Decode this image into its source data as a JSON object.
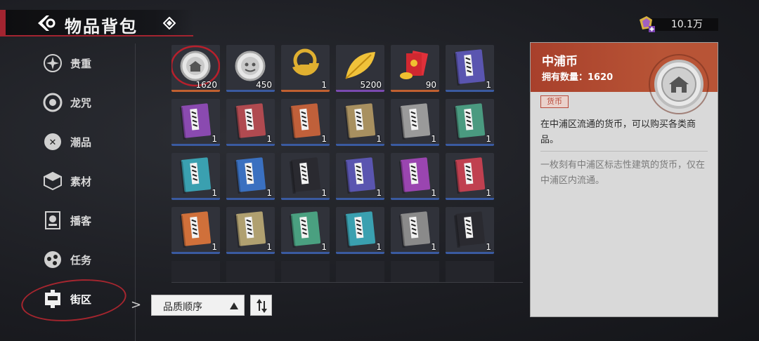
{
  "header": {
    "title": "物品背包"
  },
  "currency": {
    "amount": "10.1万"
  },
  "sidebar": {
    "items": [
      {
        "label": "贵重",
        "icon": "valuable-icon"
      },
      {
        "label": "龙咒",
        "icon": "dragon-spell-icon"
      },
      {
        "label": "潮品",
        "icon": "trend-icon"
      },
      {
        "label": "素材",
        "icon": "material-icon"
      },
      {
        "label": "播客",
        "icon": "podcast-icon"
      },
      {
        "label": "任务",
        "icon": "quest-icon"
      },
      {
        "label": "街区",
        "icon": "district-icon",
        "active": true
      }
    ]
  },
  "grid": {
    "items": [
      {
        "kind": "coin-silver-building",
        "qty": "1620",
        "rarity": "#c06030",
        "selected": true
      },
      {
        "kind": "coin-silver-face",
        "qty": "450",
        "rarity": "#3a5aa0"
      },
      {
        "kind": "gold-half-coin",
        "qty": "1",
        "rarity": "#c06030"
      },
      {
        "kind": "gold-leaf",
        "qty": "5200",
        "rarity": "#7a4ab0"
      },
      {
        "kind": "red-envelope",
        "qty": "90",
        "rarity": "#c06030"
      },
      {
        "kind": "book",
        "color": "#5a55b0",
        "qty": "1",
        "rarity": "#3a5aa0"
      },
      {
        "kind": "book",
        "color": "#8a4ab0",
        "qty": "1",
        "rarity": "#3a5aa0"
      },
      {
        "kind": "book",
        "color": "#b04a50",
        "qty": "1",
        "rarity": "#3a5aa0"
      },
      {
        "kind": "book",
        "color": "#c0603a",
        "qty": "1",
        "rarity": "#3a5aa0"
      },
      {
        "kind": "book",
        "color": "#a89060",
        "qty": "1",
        "rarity": "#3a5aa0"
      },
      {
        "kind": "book",
        "color": "#9a9a9a",
        "qty": "1",
        "rarity": "#3a5aa0"
      },
      {
        "kind": "book",
        "color": "#4a9a80",
        "qty": "1",
        "rarity": "#3a5aa0"
      },
      {
        "kind": "book",
        "color": "#3aa0b0",
        "qty": "1",
        "rarity": "#3a5aa0"
      },
      {
        "kind": "book",
        "color": "#3a70c0",
        "qty": "1",
        "rarity": "#3a5aa0"
      },
      {
        "kind": "book",
        "color": "#2a2a30",
        "qty": "1",
        "rarity": "#3a5aa0"
      },
      {
        "kind": "book",
        "color": "#5a55b0",
        "qty": "1",
        "rarity": "#3a5aa0"
      },
      {
        "kind": "book",
        "color": "#9a45b0",
        "qty": "1",
        "rarity": "#3a5aa0"
      },
      {
        "kind": "book",
        "color": "#c04050",
        "qty": "1",
        "rarity": "#3a5aa0"
      },
      {
        "kind": "book",
        "color": "#d0703a",
        "qty": "1",
        "rarity": "#3a5aa0"
      },
      {
        "kind": "book",
        "color": "#b0a070",
        "qty": "1",
        "rarity": "#3a5aa0"
      },
      {
        "kind": "book",
        "color": "#4aa080",
        "qty": "1",
        "rarity": "#3a5aa0"
      },
      {
        "kind": "book",
        "color": "#3aa0b0",
        "qty": "1",
        "rarity": "#3a5aa0"
      },
      {
        "kind": "book",
        "color": "#8a8a8a",
        "qty": "1",
        "rarity": "#3a5aa0"
      },
      {
        "kind": "book",
        "color": "#2a2a30",
        "qty": "1",
        "rarity": "#3a5aa0"
      }
    ]
  },
  "sort": {
    "label": "品质顺序"
  },
  "detail": {
    "name": "中浦币",
    "count": "拥有数量：1620",
    "tag": "货币",
    "description": "在中浦区流通的货币，可以购买各类商品。",
    "flavor": "一枚刻有中浦区标志性建筑的货币，仅在中浦区内流通。"
  }
}
